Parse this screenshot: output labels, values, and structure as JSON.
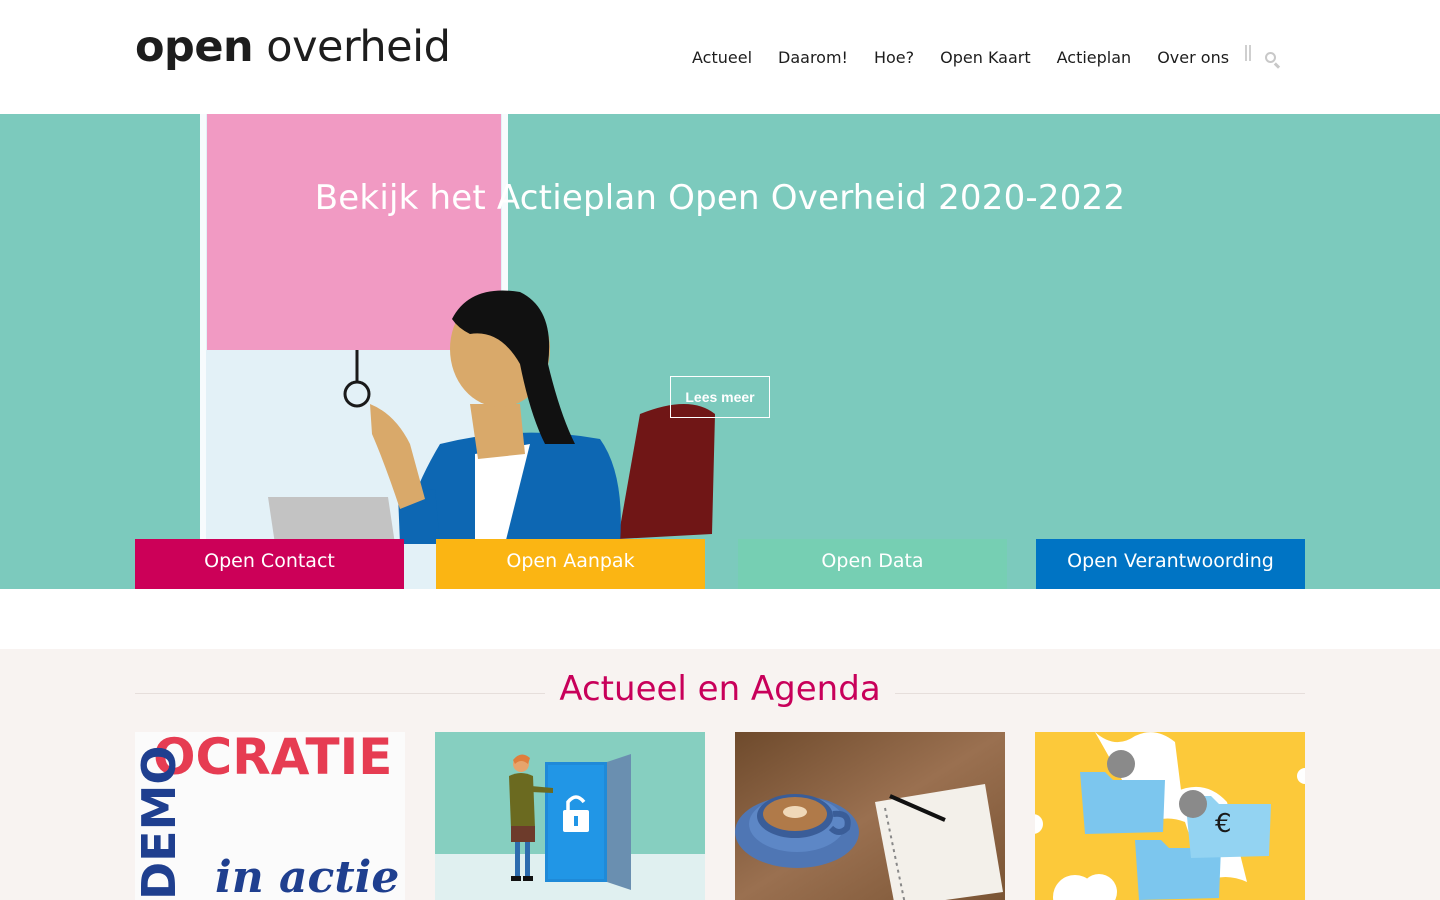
{
  "header": {
    "logo_bold": "open",
    "logo_light": "overheid",
    "nav": [
      "Actueel",
      "Daarom!",
      "Hoe?",
      "Open Kaart",
      "Actieplan",
      "Over ons"
    ],
    "search_icon": "search-icon"
  },
  "hero": {
    "title": "Bekijk het Actieplan Open Overheid 2020-2022",
    "button_label": "Lees meer",
    "background_color": "#7ccabd"
  },
  "tiles": [
    {
      "label": "Open Contact",
      "color": "#cc0058"
    },
    {
      "label": "Open Aanpak",
      "color": "#fbb513"
    },
    {
      "label": "Open Data",
      "color": "#76cfb3"
    },
    {
      "label": "Open Verantwoording",
      "color": "#0074c4"
    }
  ],
  "actueel": {
    "title": "Actueel en Agenda",
    "cards": [
      {
        "image": "democratie-in-actie-poster",
        "text_top": "OCRATIE",
        "text_side": "DEMO",
        "text_script": "in actie"
      },
      {
        "image": "woman-opening-lock-door-illustration"
      },
      {
        "image": "coffee-and-notebook-photo"
      },
      {
        "image": "euro-folders-illustration",
        "symbol": "€"
      }
    ]
  }
}
